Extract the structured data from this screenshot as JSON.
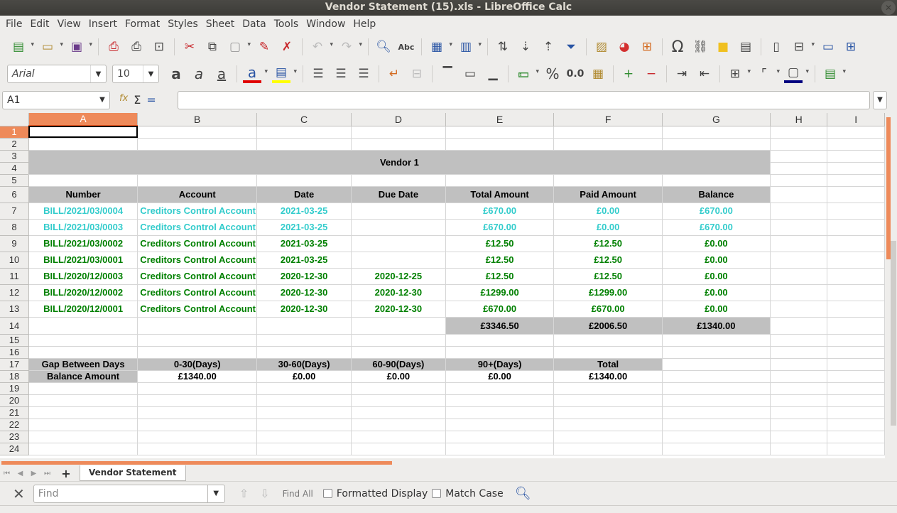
{
  "window": {
    "title": "Vendor Statement (15).xls - LibreOffice Calc"
  },
  "menu": [
    "File",
    "Edit",
    "View",
    "Insert",
    "Format",
    "Styles",
    "Sheet",
    "Data",
    "Tools",
    "Window",
    "Help"
  ],
  "toolbar": {
    "font_name": "Arial",
    "font_size": "10",
    "percent_label": "%",
    "decimal_label": "0.0"
  },
  "formula_bar": {
    "cell_ref": "A1",
    "fx": "fx",
    "sum": "Σ",
    "eq": "="
  },
  "columns": [
    "A",
    "B",
    "C",
    "D",
    "E",
    "F",
    "G",
    "H",
    "I"
  ],
  "rows": [
    "1",
    "2",
    "3",
    "4",
    "5",
    "6",
    "7",
    "8",
    "9",
    "10",
    "11",
    "12",
    "13",
    "14",
    "15",
    "16",
    "17",
    "18",
    "19",
    "20",
    "21",
    "22",
    "23",
    "24"
  ],
  "sheet": {
    "vendor_title": "Vendor 1",
    "headers": [
      "Number",
      "Account",
      "Date",
      "Due Date",
      "Total Amount",
      "Paid Amount",
      "Balance"
    ],
    "bills": [
      {
        "number": "BILL/2021/03/0004",
        "account": "Creditors Control Account",
        "date": "2021-03-25",
        "due": "",
        "total": "£670.00",
        "paid": "£0.00",
        "balance": "£670.00",
        "color": "#33cccc"
      },
      {
        "number": "BILL/2021/03/0003",
        "account": "Creditors Control Account",
        "date": "2021-03-25",
        "due": "",
        "total": "£670.00",
        "paid": "£0.00",
        "balance": "£670.00",
        "color": "#33cccc"
      },
      {
        "number": "BILL/2021/03/0002",
        "account": "Creditors Control Account",
        "date": "2021-03-25",
        "due": "",
        "total": "£12.50",
        "paid": "£12.50",
        "balance": "£0.00",
        "color": "#008000"
      },
      {
        "number": "BILL/2021/03/0001",
        "account": "Creditors Control Account",
        "date": "2021-03-25",
        "due": "",
        "total": "£12.50",
        "paid": "£12.50",
        "balance": "£0.00",
        "color": "#008000"
      },
      {
        "number": "BILL/2020/12/0003",
        "account": "Creditors Control Account",
        "date": "2020-12-30",
        "due": "2020-12-25",
        "total": "£12.50",
        "paid": "£12.50",
        "balance": "£0.00",
        "color": "#008000"
      },
      {
        "number": "BILL/2020/12/0002",
        "account": "Creditors Control Account",
        "date": "2020-12-30",
        "due": "2020-12-30",
        "total": "£1299.00",
        "paid": "£1299.00",
        "balance": "£0.00",
        "color": "#008000"
      },
      {
        "number": "BILL/2020/12/0001",
        "account": "Creditors Control Account",
        "date": "2020-12-30",
        "due": "2020-12-30",
        "total": "£670.00",
        "paid": "£670.00",
        "balance": "£0.00",
        "color": "#008000"
      }
    ],
    "totals": {
      "total": "£3346.50",
      "paid": "£2006.50",
      "balance": "£1340.00"
    },
    "aging_headers": [
      "Gap Between Days",
      "0-30(Days)",
      "30-60(Days)",
      "60-90(Days)",
      "90+(Days)",
      "Total"
    ],
    "aging_values": [
      "Balance Amount",
      "£1340.00",
      "£0.00",
      "£0.00",
      "£0.00",
      "£1340.00"
    ]
  },
  "tabs": {
    "active": "Vendor Statement"
  },
  "findbar": {
    "placeholder": "Find",
    "find_all": "Find All",
    "formatted_display": "Formatted Display",
    "match_case": "Match Case"
  }
}
